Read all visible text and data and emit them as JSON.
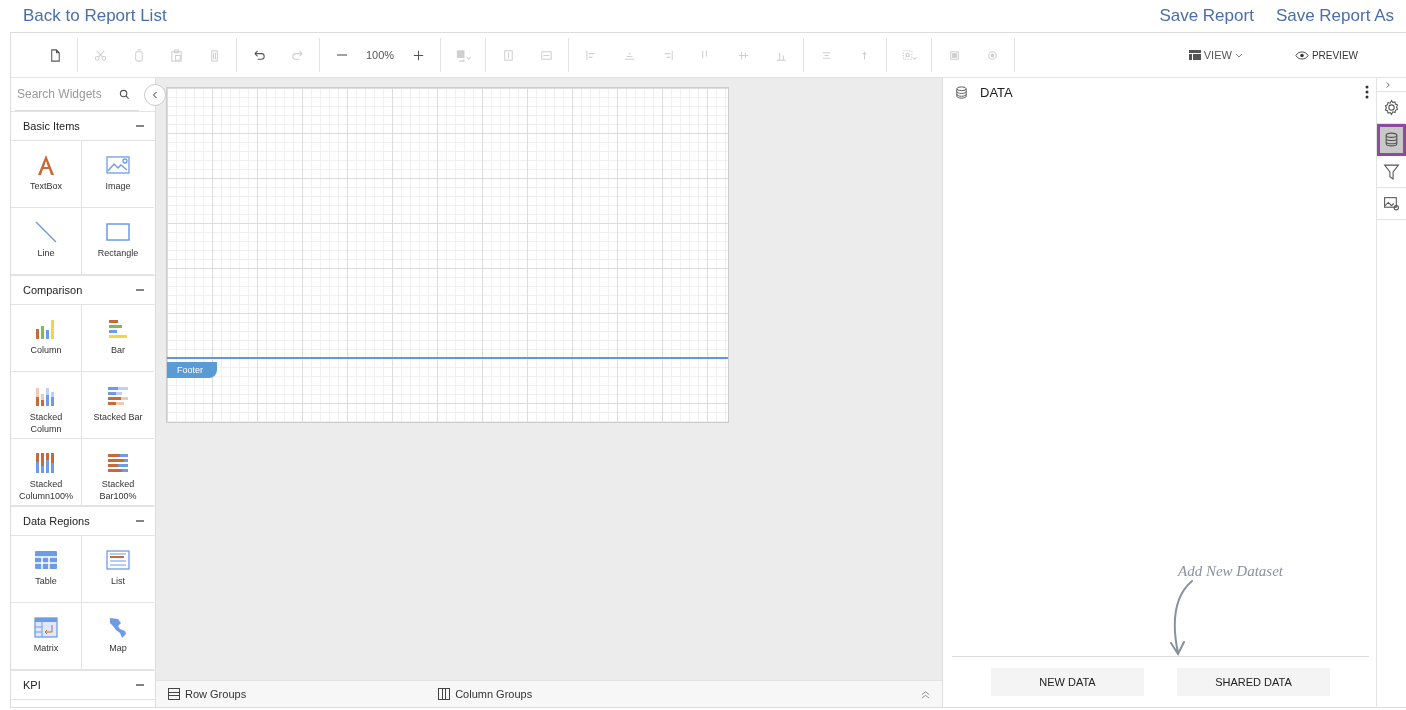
{
  "header": {
    "back_link": "Back to Report List",
    "actions": [
      "Save Report",
      "Save Report As"
    ]
  },
  "toolbar": {
    "groups": [
      [
        {
          "kind": "new",
          "disabled": false
        }
      ],
      [
        {
          "kind": "cut",
          "disabled": true
        },
        {
          "kind": "copy",
          "disabled": true
        },
        {
          "kind": "paste",
          "disabled": true
        },
        {
          "kind": "delete",
          "disabled": true
        }
      ],
      [
        {
          "kind": "undo",
          "disabled": false
        },
        {
          "kind": "redo",
          "disabled": true
        }
      ],
      [
        {
          "kind": "zoom-out",
          "disabled": false
        },
        {
          "kind": "zoom-level",
          "text": "100%",
          "disabled": false
        },
        {
          "kind": "zoom-in",
          "disabled": false
        }
      ],
      [
        {
          "kind": "fill",
          "disabled": true
        }
      ],
      [
        {
          "kind": "same-width",
          "disabled": true
        },
        {
          "kind": "same-height",
          "disabled": true
        }
      ],
      [
        {
          "kind": "align-left",
          "disabled": true
        },
        {
          "kind": "align-center",
          "disabled": true
        },
        {
          "kind": "align-right",
          "disabled": true
        },
        {
          "kind": "align-top",
          "disabled": true
        },
        {
          "kind": "align-middle",
          "disabled": true
        },
        {
          "kind": "align-bottom",
          "disabled": true
        }
      ],
      [
        {
          "kind": "space-h",
          "disabled": true
        },
        {
          "kind": "space-v",
          "disabled": true
        }
      ],
      [
        {
          "kind": "grid",
          "disabled": true
        }
      ],
      [
        {
          "kind": "front",
          "disabled": true
        },
        {
          "kind": "back",
          "disabled": true
        }
      ]
    ],
    "view": "VIEW",
    "preview": "PREVIEW"
  },
  "widgets": {
    "search": {
      "placeholder": "Search Widgets"
    },
    "sections": [
      {
        "title": "Basic Items",
        "expanded": true,
        "items": [
          {
            "label": "TextBox",
            "kind": "textbox"
          },
          {
            "label": "Image",
            "kind": "image"
          },
          {
            "label": "Line",
            "kind": "line"
          },
          {
            "label": "Rectangle",
            "kind": "rectangle"
          }
        ]
      },
      {
        "title": "Comparison",
        "expanded": true,
        "items": [
          {
            "label": "Column",
            "kind": "column"
          },
          {
            "label": "Bar",
            "kind": "bar"
          },
          {
            "label": "Stacked Column",
            "kind": "stacked-column"
          },
          {
            "label": "Stacked Bar",
            "kind": "stacked-bar"
          },
          {
            "label": "Stacked Column100%",
            "kind": "stacked-column100"
          },
          {
            "label": "Stacked Bar100%",
            "kind": "stacked-bar100"
          }
        ]
      },
      {
        "title": "Data Regions",
        "expanded": true,
        "items": [
          {
            "label": "Table",
            "kind": "table"
          },
          {
            "label": "List",
            "kind": "list"
          },
          {
            "label": "Matrix",
            "kind": "matrix"
          },
          {
            "label": "Map",
            "kind": "map"
          }
        ]
      },
      {
        "title": "KPI",
        "expanded": true
      }
    ]
  },
  "canvas": {
    "footer_label": "Footer"
  },
  "groups_bar": {
    "row_groups": "Row Groups",
    "column_groups": "Column Groups"
  },
  "data_panel": {
    "title": "DATA",
    "hint": "Add New Dataset",
    "buttons": [
      "NEW DATA",
      "SHARED DATA"
    ]
  },
  "side_tabs": [
    {
      "kind": "collapse",
      "selected": false
    },
    {
      "kind": "settings",
      "selected": false
    },
    {
      "kind": "data",
      "selected": true
    },
    {
      "kind": "filter",
      "selected": false
    },
    {
      "kind": "image-settings",
      "selected": false
    }
  ]
}
